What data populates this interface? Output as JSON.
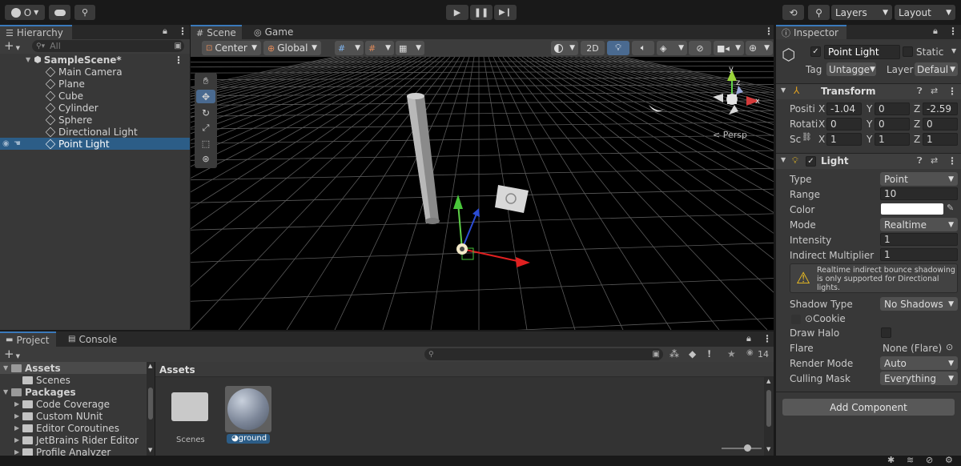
{
  "topbar": {
    "account_label": "O",
    "layers_label": "Layers",
    "layout_label": "Layout"
  },
  "hierarchy": {
    "tab_label": "Hierarchy",
    "search_placeholder": "All",
    "scene_name": "SampleScene*",
    "items": [
      {
        "label": "Main Camera"
      },
      {
        "label": "Plane"
      },
      {
        "label": "Cube"
      },
      {
        "label": "Cylinder"
      },
      {
        "label": "Sphere"
      },
      {
        "label": "Directional Light"
      },
      {
        "label": "Point Light"
      }
    ]
  },
  "scene": {
    "tab_scene": "Scene",
    "tab_game": "Game",
    "pivot_label": "Center",
    "space_label": "Global",
    "mode_2d": "2D",
    "persp_label": "< Persp",
    "gizmo_y": "y",
    "gizmo_z": "z",
    "gizmo_x": "x"
  },
  "project": {
    "tab_project": "Project",
    "tab_console": "Console",
    "hidden_count": "14",
    "assets_header": "Assets",
    "tree": [
      {
        "label": "Assets",
        "level": 0,
        "open": true,
        "bold": true
      },
      {
        "label": "Scenes",
        "level": 1,
        "open": false,
        "bold": false
      },
      {
        "label": "Packages",
        "level": 0,
        "open": true,
        "bold": true
      },
      {
        "label": "Code Coverage",
        "level": 1,
        "open": false,
        "bold": false
      },
      {
        "label": "Custom NUnit",
        "level": 1,
        "open": false,
        "bold": false
      },
      {
        "label": "Editor Coroutines",
        "level": 1,
        "open": false,
        "bold": false
      },
      {
        "label": "JetBrains Rider Editor",
        "level": 1,
        "open": false,
        "bold": false
      },
      {
        "label": "Profile Analyzer",
        "level": 1,
        "open": false,
        "bold": false
      }
    ],
    "asset_scenes": "Scenes",
    "asset_ground": "ground"
  },
  "inspector": {
    "tab_label": "Inspector",
    "object_name": "Point Light",
    "static_label": "Static",
    "tag_label": "Tag",
    "tag_value": "Untagge",
    "layer_label": "Layer",
    "layer_value": "Defaul",
    "transform_title": "Transform",
    "position_label": "Positi",
    "rotation_label": "Rotati",
    "scale_label": "Sc",
    "axis_x": "X",
    "axis_y": "Y",
    "axis_z": "Z",
    "position": {
      "x": "-1.04",
      "y": "0",
      "z": "-2.59"
    },
    "rotation": {
      "x": "0",
      "y": "0",
      "z": "0"
    },
    "scale": {
      "x": "1",
      "y": "1",
      "z": "1"
    },
    "light_title": "Light",
    "type_label": "Type",
    "type_value": "Point",
    "range_label": "Range",
    "range_value": "10",
    "color_label": "Color",
    "color_value": "#ffffff",
    "mode_label": "Mode",
    "mode_value": "Realtime",
    "intensity_label": "Intensity",
    "intensity_value": "1",
    "indirect_label": "Indirect Multiplier",
    "indirect_value": "1",
    "warning_text": "Realtime indirect bounce shadowing is only supported for Directional lights.",
    "shadow_label": "Shadow Type",
    "shadow_value": "No Shadows",
    "cookie_label": "Cookie",
    "draw_halo_label": "Draw Halo",
    "flare_label": "Flare",
    "flare_value": "None (Flare)",
    "render_mode_label": "Render Mode",
    "render_mode_value": "Auto",
    "culling_label": "Culling Mask",
    "culling_value": "Everything",
    "add_component_label": "Add Component"
  },
  "colors": {
    "accent": "#3a79bb",
    "selection": "#2c5d87",
    "warning": "#f0c020"
  }
}
